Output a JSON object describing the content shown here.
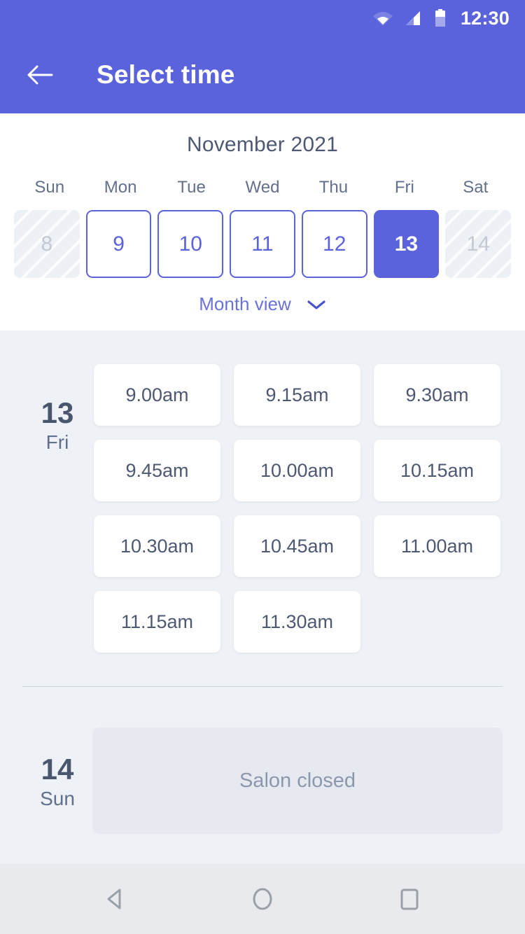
{
  "statusbar": {
    "time": "12:30",
    "icons": [
      "wifi-icon",
      "signal-icon",
      "battery-icon"
    ]
  },
  "appbar": {
    "title": "Select time",
    "back_icon": "back-arrow-icon"
  },
  "calendar": {
    "month_title": "November 2021",
    "weekdays": [
      "Sun",
      "Mon",
      "Tue",
      "Wed",
      "Thu",
      "Fri",
      "Sat"
    ],
    "days": [
      {
        "num": "8",
        "state": "disabled"
      },
      {
        "num": "9",
        "state": "available"
      },
      {
        "num": "10",
        "state": "available"
      },
      {
        "num": "11",
        "state": "available"
      },
      {
        "num": "12",
        "state": "available"
      },
      {
        "num": "13",
        "state": "selected"
      },
      {
        "num": "14",
        "state": "disabled"
      }
    ],
    "month_view_label": "Month view",
    "month_view_icon": "chevron-down-icon"
  },
  "schedule": [
    {
      "day_number": "13",
      "day_name": "Fri",
      "slots": [
        "9.00am",
        "9.15am",
        "9.30am",
        "9.45am",
        "10.00am",
        "10.15am",
        "10.30am",
        "10.45am",
        "11.00am",
        "11.15am",
        "11.30am"
      ],
      "closed_message": null
    },
    {
      "day_number": "14",
      "day_name": "Sun",
      "slots": [],
      "closed_message": "Salon closed"
    }
  ],
  "navbar": {
    "back": "nav-back-icon",
    "home": "nav-home-icon",
    "recents": "nav-recents-icon"
  },
  "colors": {
    "accent": "#5b63dc",
    "surface": "#ffffff",
    "background": "#eef1f6",
    "text_dark": "#4d5872",
    "text_muted": "#8d97ac",
    "disabled": "#c3c8d2"
  }
}
